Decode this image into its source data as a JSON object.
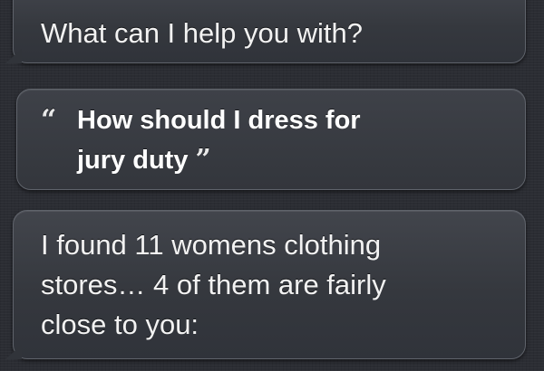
{
  "conversation": {
    "siri_prompt": "What can I help you with?",
    "user_query": {
      "open_quote": "“",
      "line1": "How should I dress for",
      "line2": "jury duty",
      "close_quote": "”"
    },
    "siri_response": {
      "line1": "I found 11 womens clothing",
      "line2": "stores… 4 of them are fairly",
      "line3": "close to you:"
    }
  },
  "colors": {
    "background": "#2b2d33",
    "bubble": "#3a3d43",
    "bubble_border": "#5f636b",
    "text": "#f2f2f2"
  }
}
